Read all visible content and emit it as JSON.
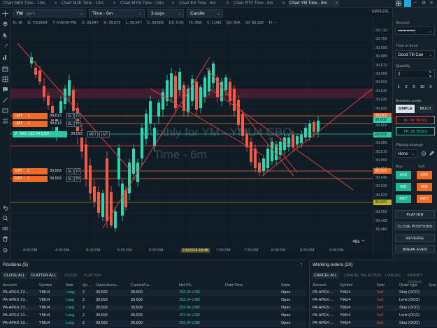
{
  "tabs": [
    {
      "label": "Chart MES Time - 10m",
      "active": false
    },
    {
      "label": "Chart M2K Time - 10m",
      "active": false
    },
    {
      "label": "Chart MYM Time - 10m",
      "active": false
    },
    {
      "label": "Chart ES Time - 6m",
      "active": false
    },
    {
      "label": "Chart RTY Time - 6m",
      "active": false
    },
    {
      "label": "Chart YM Time - 6m",
      "active": true
    }
  ],
  "manual_label": "MANUAL",
  "toolbar": {
    "symbol": "YM",
    "symbol_sub": "μym",
    "interval": "Time - 6m",
    "range": "3 days",
    "chart_style": "Candle"
  },
  "stats": {
    "b": "B: 18",
    "d": "D: 7/5/2024",
    "t": "T: 6:42:00 PM",
    "o": "O: 39,647",
    "h": "H: 39,672",
    "l": "L: 39,647",
    "c": "C: 39,669",
    "ch": "Ch: 0.06",
    "tk": "Tk: 898",
    "v": "V: 1,043",
    "qv": "QV: N/A",
    "oi": "OI: 83,318",
    "fr": "Fr: --"
  },
  "watermark": {
    "line1": "Monthly for YM - YMU4 CBO",
    "line2": "Time - 6m"
  },
  "price_ticks": [
    "39,710",
    "39,700",
    "39,690",
    "39,680",
    "39,670",
    "39,660",
    "39,650",
    "39,640",
    "39,630",
    "39,620",
    "39,610",
    "39,600",
    "39,590",
    "39,580",
    "39,570",
    "39,560",
    "39,550",
    "39,540",
    "39,530",
    "39,520",
    "39,510",
    "39,500",
    "39,490",
    "39,480"
  ],
  "price_labels": {
    "l1": "39,619",
    "l2": "39,609",
    "l3": "39,593",
    "l4": "39,553",
    "l5": "39,520"
  },
  "time_ticks": [
    "4:00 PM",
    "4:30 PM",
    "5:00 PM",
    "5:30 PM",
    "6:00 PM",
    "7/5/2024 18:48",
    "7:00 PM",
    "7:30 PM",
    "8:00 PM",
    "8:30 PM",
    "9:00 PM"
  ],
  "countdown": "49s",
  "break_even": "Break even",
  "orders": [
    {
      "type": "LMT",
      "qty": "1",
      "price": "39,613",
      "color": "#f06a2a"
    },
    {
      "type": "LMT",
      "qty": "1",
      "price": "39,613",
      "color": "#f06a2a"
    },
    {
      "type": "2",
      "qty": "Net: 152.04 USD",
      "price": "39,593",
      "color": "#2bc7a3"
    },
    {
      "type": "STP",
      "qty": "1",
      "price": "39,553",
      "color": "#f06a2a"
    },
    {
      "type": "STP",
      "qty": "1",
      "price": "39,553",
      "color": "#f06a2a"
    }
  ],
  "order_buttons": {
    "sl": "SL",
    "tp": "TP",
    "mkt": "MKT",
    "lmt": "LMT",
    "stp": "STP"
  },
  "right_panel": {
    "account_label": "Account",
    "account_value": "••••••••••••",
    "tif_label": "Time in force",
    "tif_value": "Good Till Can",
    "qty_label": "Quantity",
    "qty_value": "2",
    "qty_presets": [
      "1",
      "2",
      "5",
      "10",
      "X"
    ],
    "brackets_label": "Brackets mode",
    "simple": "SIMPLE",
    "multi": "MULTI",
    "sl_ticks": "SL: 40 TICKS",
    "tp_ticks": "TP: 30 TICKS",
    "strategy_label": "Placing strategy",
    "strategy_value": "None",
    "buy_label": "Buy",
    "sell_label": "Sell",
    "ask": "ASK",
    "bid": "BID",
    "mkt": "MKT",
    "flatten": "FLATTEN",
    "close_positions": "CLOSE POSITIONS",
    "reverse": "REVERSE",
    "break_even": "BREAK EVEN"
  },
  "positions": {
    "title": "Positions (5)",
    "buttons": [
      "CLOSE ALL",
      "FLATTEN ALL",
      "CLOSE",
      "FLATTEN"
    ],
    "headers": [
      "Account",
      "Symbol",
      "Side",
      "Qu...",
      "Open/Avera...",
      "Current/La...",
      "Net P/L",
      "Date/Time",
      "State"
    ],
    "rows": [
      [
        "PA-APEX-13...",
        "YMU4",
        "Long",
        "2",
        "39,593",
        "39,609",
        "152.04 USD",
        "",
        "Open"
      ],
      [
        "PA-APEX-13...",
        "YMU4",
        "Long",
        "2",
        "39,593",
        "39,609",
        "152.04 USD",
        "",
        "Open"
      ],
      [
        "PA-APEX-13...",
        "YMU4",
        "Long",
        "2",
        "39,593",
        "39,609",
        "152.04 USD",
        "",
        "Open"
      ],
      [
        "PA-APEX-13...",
        "YMU4",
        "Long",
        "2",
        "39,593",
        "39,609",
        "152.04 USD",
        "",
        "Open"
      ],
      [
        "PA-APEX-13...",
        "YMU4",
        "Long",
        "2",
        "39,593",
        "39,609",
        "152.04 USD",
        "",
        "Open"
      ]
    ]
  },
  "working": {
    "title": "Working orders (20)",
    "buttons": [
      "CANCEL ALL",
      "CANCEL SELECTED",
      "CANCEL",
      "MODIFY ORDER"
    ],
    "headers": [
      "Account",
      "Symbol",
      "Side",
      "Order type",
      "Qua"
    ],
    "rows": [
      [
        "PA-APEX-...",
        "YMU4",
        "Sell",
        "Stop (OCO)"
      ],
      [
        "PA-APEX-...",
        "YMU4",
        "Sell",
        "Limit (OCO)"
      ],
      [
        "PA-APEX-...",
        "YMU4",
        "Sell",
        "Stop (OCO)"
      ],
      [
        "PA-APEX-...",
        "YMU4",
        "Sell",
        "Limit (OCO)"
      ],
      [
        "PA-APEX-...",
        "YMU4",
        "Sell",
        "Stop (OCO)"
      ]
    ]
  },
  "colors": {
    "up": "#26d7b0",
    "down": "#f25a4a",
    "trend": "#e0403a",
    "order": "#f06a2a",
    "position": "#2bc7a3"
  }
}
